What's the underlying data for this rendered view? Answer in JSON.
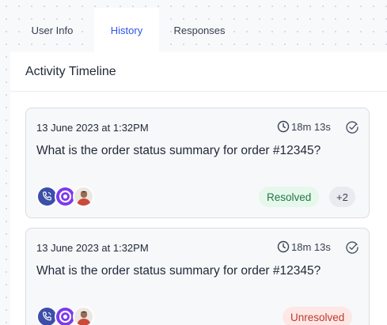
{
  "tabs": [
    {
      "label": "User Info",
      "active": false
    },
    {
      "label": "History",
      "active": true
    },
    {
      "label": "Responses",
      "active": false
    }
  ],
  "panel": {
    "title": "Activity Timeline"
  },
  "cards": [
    {
      "date": "13 June 2023 at 1:32PM",
      "duration": "18m 13s",
      "question": "What is the order status summary for order #12345?",
      "status": "Resolved",
      "extra_count": "+2"
    },
    {
      "date": "13 June 2023 at 1:32PM",
      "duration": "18m 13s",
      "question": "What is the order status summary for order #12345?",
      "status": "Unresolved"
    }
  ],
  "icons": {
    "duration": "clock-icon",
    "action": "check-circle-icon",
    "avatar_1": "phone-icon",
    "avatar_2": "brand-logo-icon",
    "avatar_3": "user-photo"
  },
  "colors": {
    "accent": "#2f54eb",
    "resolved_bg": "#e6f7ec",
    "resolved_text": "#1f7a43",
    "unresolved_bg": "#fde8e6",
    "unresolved_text": "#c0392b"
  }
}
